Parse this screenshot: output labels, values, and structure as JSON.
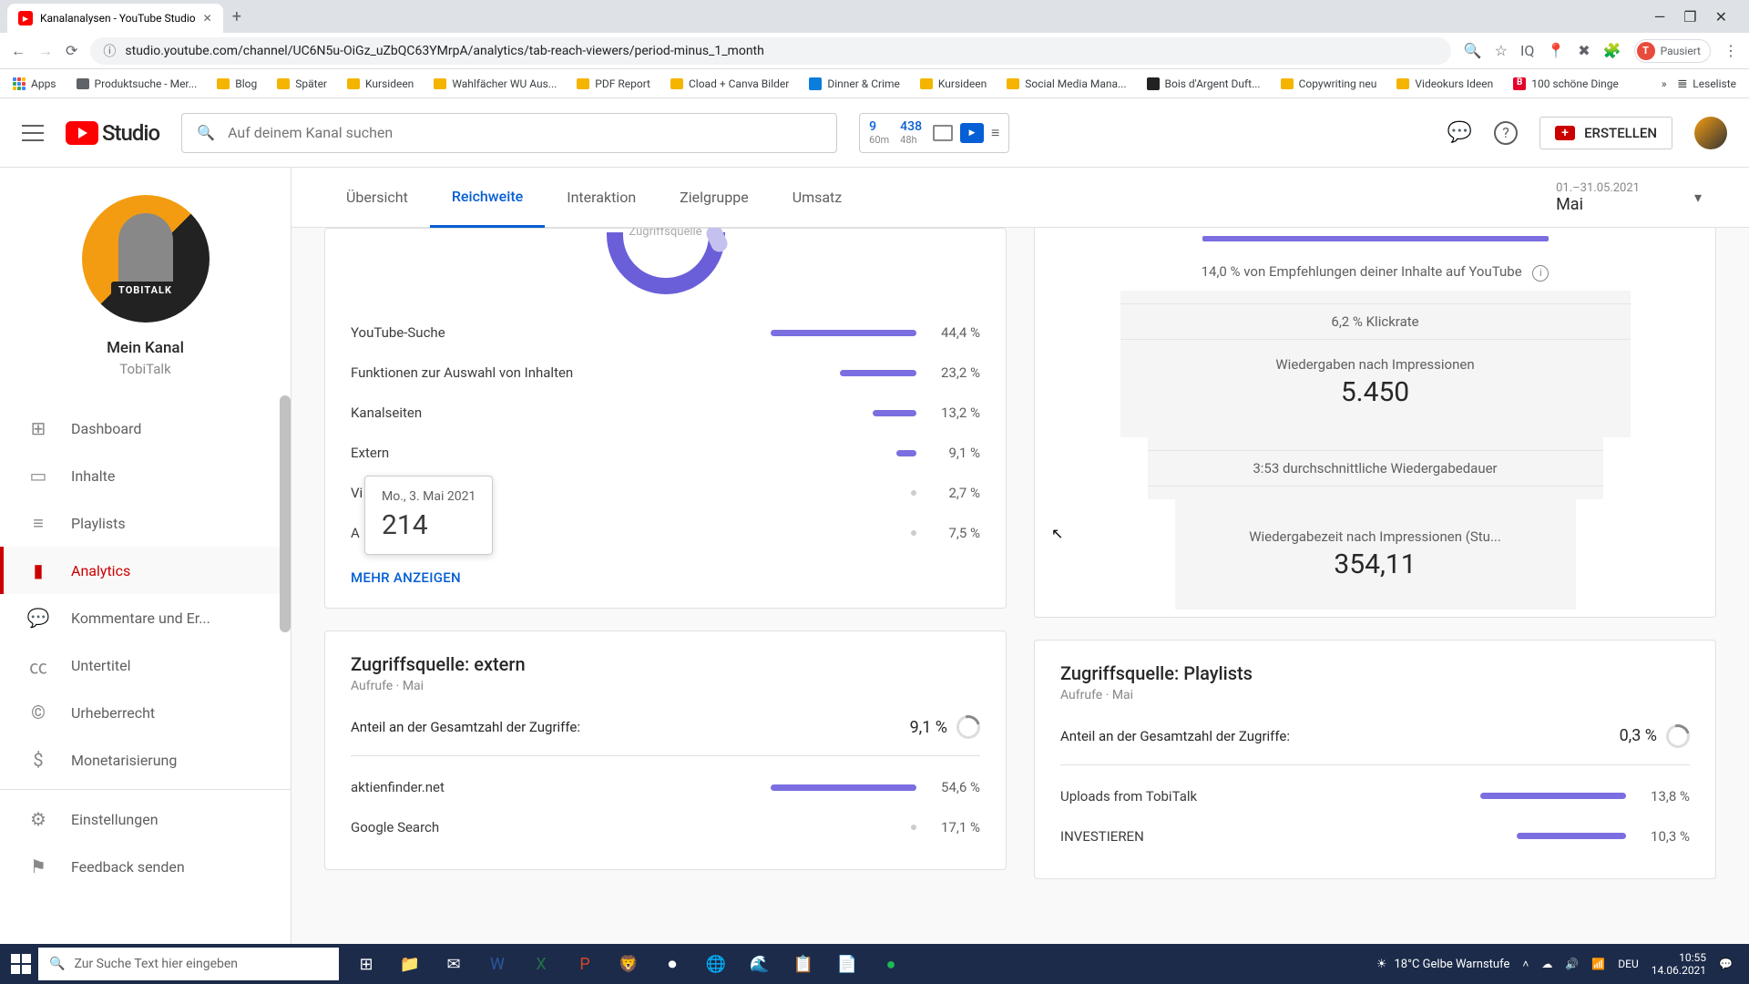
{
  "browser": {
    "tab_title": "Kanalanalysen - YouTube Studio",
    "url": "studio.youtube.com/channel/UC6N5u-OiGz_uZbQC63YMrpA/analytics/tab-reach-viewers/period-minus_1_month",
    "profile_label": "Pausiert",
    "profile_initial": "T",
    "bookmarks": [
      "Apps",
      "Produktsuche - Mer...",
      "Blog",
      "Später",
      "Kursideen",
      "Wahlfächer WU Aus...",
      "PDF Report",
      "Cload + Canva Bilder",
      "Dinner & Crime",
      "Kursideen",
      "Social Media Mana...",
      "Bois d'Argent Duft...",
      "Copywriting neu",
      "Videokurs Ideen",
      "100 schöne Dinge"
    ],
    "reading_list": "Leseliste"
  },
  "header": {
    "logo": "Studio",
    "search_placeholder": "Auf deinem Kanal suchen",
    "mini_stats": [
      {
        "num": "9",
        "sub": "60m"
      },
      {
        "num": "438",
        "sub": "48h"
      }
    ],
    "create": "ERSTELLEN"
  },
  "sidebar": {
    "channel_label": "Mein Kanal",
    "channel_name": "TobiTalk",
    "avatar_badge": "TOBITALK",
    "items": [
      {
        "label": "Dashboard",
        "icon": "⊞"
      },
      {
        "label": "Inhalte",
        "icon": "▭"
      },
      {
        "label": "Playlists",
        "icon": "≡"
      },
      {
        "label": "Analytics",
        "icon": "▮"
      },
      {
        "label": "Kommentare und Er...",
        "icon": "💬"
      },
      {
        "label": "Untertitel",
        "icon": "㏄"
      },
      {
        "label": "Urheberrecht",
        "icon": "©"
      },
      {
        "label": "Monetarisierung",
        "icon": "$"
      }
    ],
    "bottom": [
      {
        "label": "Einstellungen",
        "icon": "⚙"
      },
      {
        "label": "Feedback senden",
        "icon": "⚑"
      }
    ]
  },
  "tabs": {
    "items": [
      "Übersicht",
      "Reichweite",
      "Interaktion",
      "Zielgruppe",
      "Umsatz"
    ],
    "active": 1,
    "date_range": "01.–31.05.2021",
    "date_label": "Mai"
  },
  "sources_card": {
    "center_label": "Zugriffsquelle",
    "rows": [
      {
        "label": "YouTube-Suche",
        "pct": "44,4 %",
        "bw": 160
      },
      {
        "label": "Funktionen zur Auswahl von Inhalten",
        "pct": "23,2 %",
        "bw": 84
      },
      {
        "label": "Kanalseiten",
        "pct": "13,2 %",
        "bw": 48
      },
      {
        "label": "Extern",
        "pct": "9,1 %",
        "bw": 22
      },
      {
        "label": "Vi",
        "pct": "2,7 %",
        "bw": 0
      },
      {
        "label": "A",
        "pct": "7,5 %",
        "bw": 0
      }
    ],
    "more": "MEHR ANZEIGEN",
    "tooltip_date": "Mo., 3. Mai 2021",
    "tooltip_value": "214"
  },
  "extern_card": {
    "title": "Zugriffsquelle: extern",
    "sub": "Aufrufe · Mai",
    "share_label": "Anteil an der Gesamtzahl der Zugriffe:",
    "share_value": "9,1 %",
    "rows": [
      {
        "label": "aktienfinder.net",
        "pct": "54,6 %",
        "bw": 160
      },
      {
        "label": "Google Search",
        "pct": "17,1 %",
        "bw": 0
      }
    ]
  },
  "funnel_card": {
    "top_text": "14,0 % von Empfehlungen deiner Inhalte auf YouTube",
    "ctr": "6,2 % Klickrate",
    "views_label": "Wiedergaben nach Impressionen",
    "views": "5.450",
    "avg": "3:53 durchschnittliche Wiedergabedauer",
    "watch_label": "Wiedergabezeit nach Impressionen (Stu...",
    "watch": "354,11"
  },
  "playlists_card": {
    "title": "Zugriffsquelle: Playlists",
    "sub": "Aufrufe · Mai",
    "share_label": "Anteil an der Gesamtzahl der Zugriffe:",
    "share_value": "0,3 %",
    "rows": [
      {
        "label": "Uploads from TobiTalk",
        "pct": "13,8 %",
        "bw": 160
      },
      {
        "label": "INVESTIEREN",
        "pct": "10,3 %",
        "bw": 120
      }
    ]
  },
  "taskbar": {
    "search": "Zur Suche Text hier eingeben",
    "weather": "18°C  Gelbe Warnstufe",
    "lang": "DEU",
    "time": "10:55",
    "date": "14.06.2021"
  },
  "chart_data": {
    "type": "bar",
    "title": "Zugriffsquelle",
    "categories": [
      "YouTube-Suche",
      "Funktionen zur Auswahl von Inhalten",
      "Kanalseiten",
      "Extern",
      "Videovorschläge",
      "Andere"
    ],
    "values": [
      44.4,
      23.2,
      13.2,
      9.1,
      2.7,
      7.5
    ],
    "ylabel": "%"
  }
}
